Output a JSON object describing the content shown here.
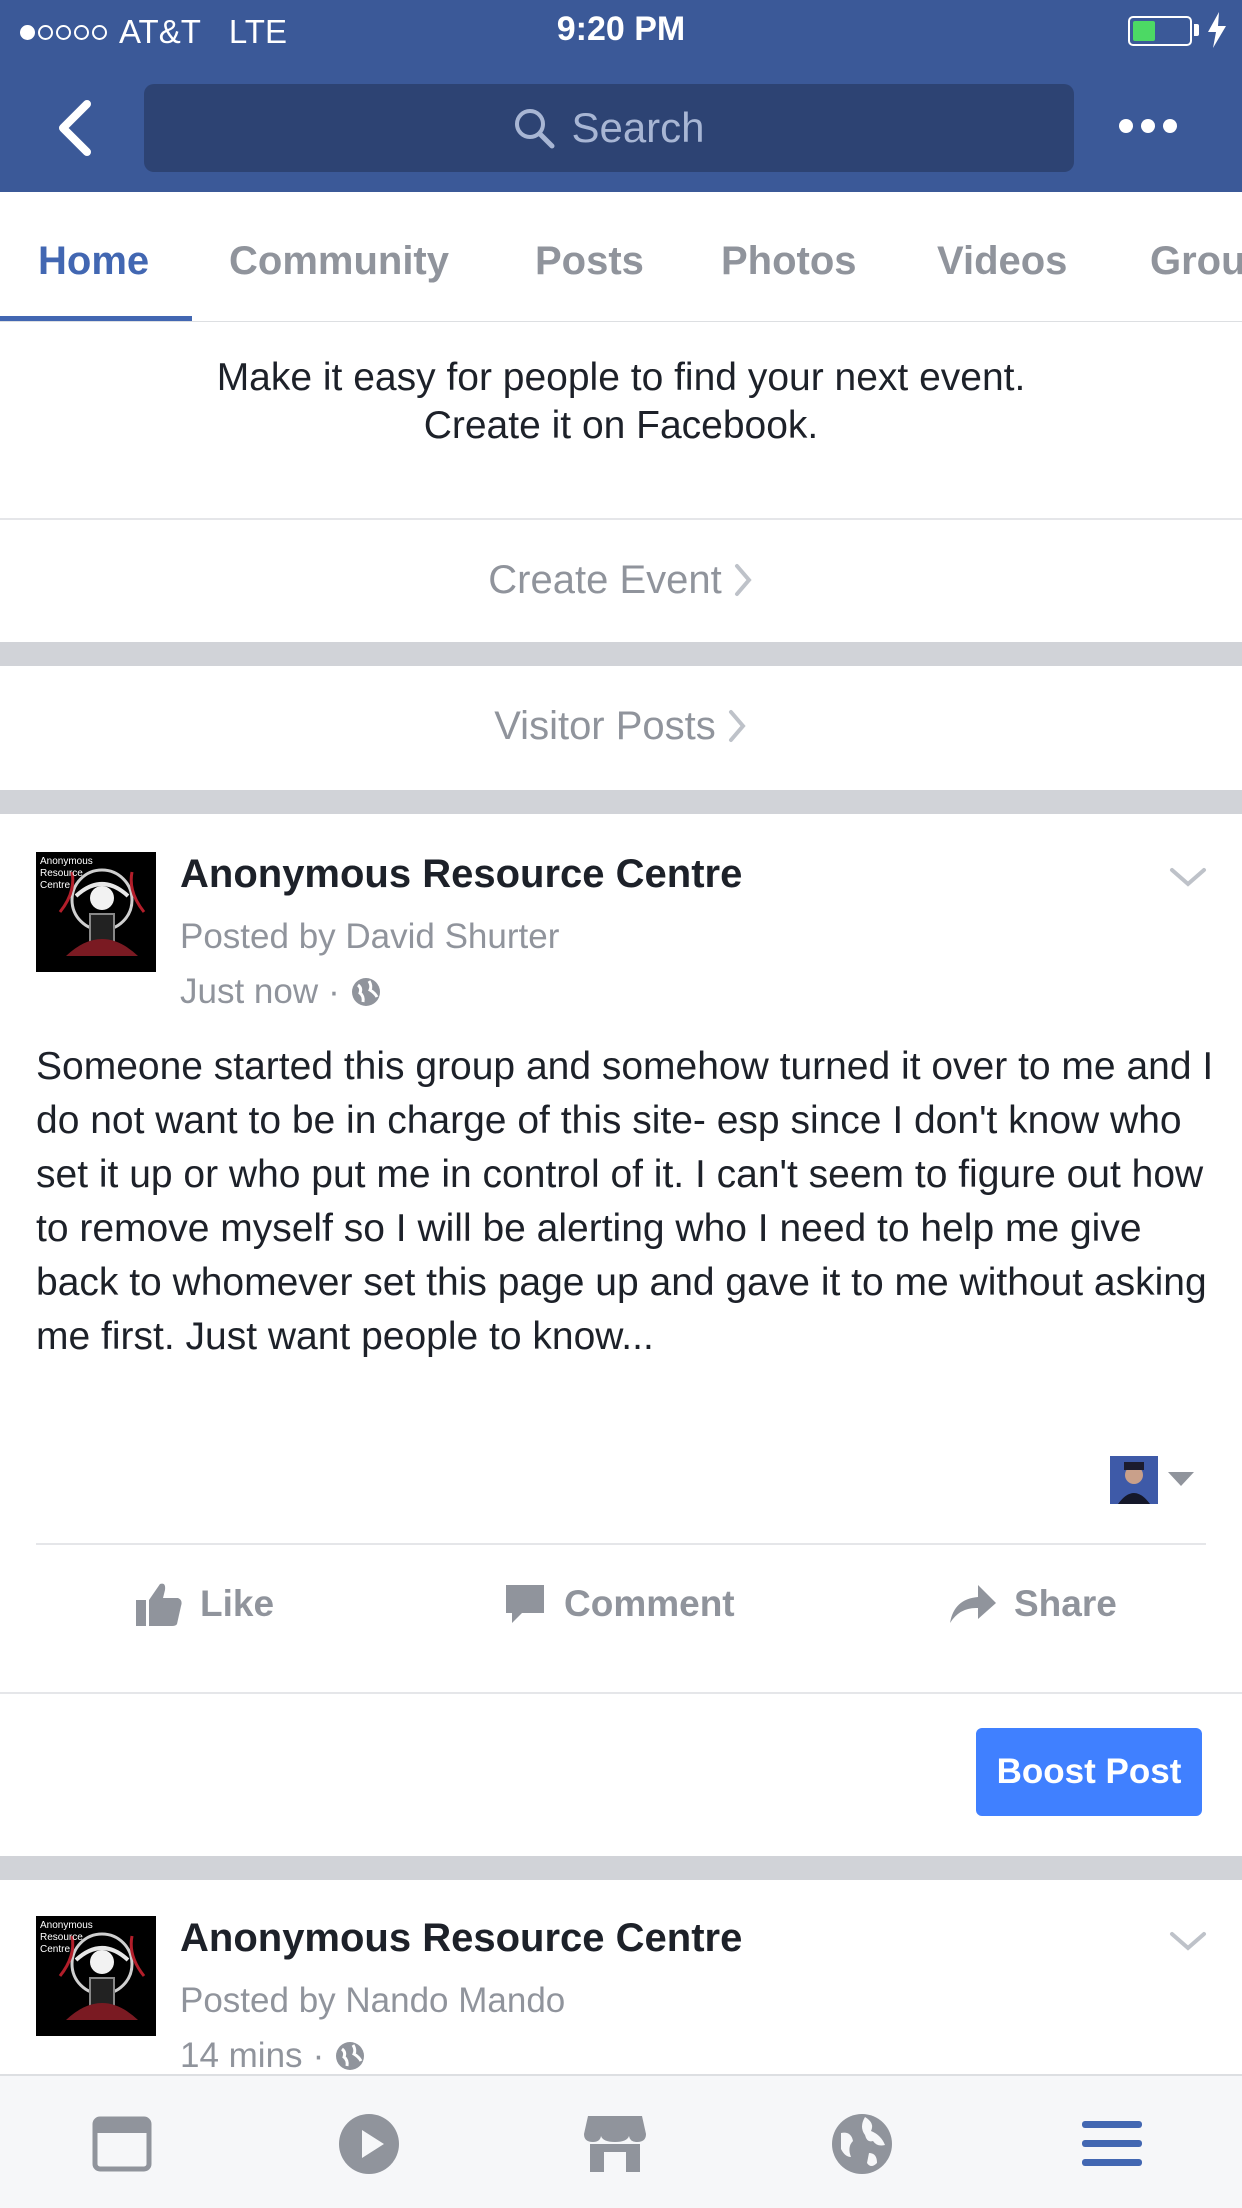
{
  "status_bar": {
    "carrier": "AT&T",
    "network": "LTE",
    "time": "9:20 PM",
    "signal_bars": 1,
    "battery_level": 0.3
  },
  "nav": {
    "search_placeholder": "Search",
    "back_icon": "chevron-left-icon",
    "more_icon": "more-dots-icon"
  },
  "tabs": [
    {
      "label": "Home",
      "active": true
    },
    {
      "label": "Community",
      "active": false
    },
    {
      "label": "Posts",
      "active": false
    },
    {
      "label": "Photos",
      "active": false
    },
    {
      "label": "Videos",
      "active": false
    },
    {
      "label": "Grou",
      "active": false
    }
  ],
  "event_promo": {
    "line1": "Make it easy for people to find your next event.",
    "line2": "Create it on Facebook.",
    "create_event_label": "Create Event"
  },
  "visitor_posts_label": "Visitor Posts",
  "posts": [
    {
      "page_name": "Anonymous Resource Centre",
      "posted_by": "Posted by David Shurter",
      "time": "Just now",
      "separator": "·",
      "avatar_text": "Anonymous Resource Centre",
      "body": "Someone started this group and somehow turned it over to me and I do not want to be in charge of this site- esp since I don't know who set it up or who put me in control of it.  I can't seem to figure out how to remove myself so I will be alerting who I need to help me give back to whomever set this page up and gave it to me without asking me first.  Just want people to know...",
      "actions": {
        "like": "Like",
        "comment": "Comment",
        "share": "Share"
      },
      "boost_label": "Boost Post"
    },
    {
      "page_name": "Anonymous Resource Centre",
      "posted_by": "Posted by Nando Mando",
      "time": "14 mins",
      "separator": "·",
      "avatar_text": "Anonymous Resource Centre"
    }
  ],
  "bottom_nav": [
    {
      "icon": "news-feed-icon",
      "active": false
    },
    {
      "icon": "video-play-icon",
      "active": false
    },
    {
      "icon": "marketplace-icon",
      "active": false
    },
    {
      "icon": "globe-notifications-icon",
      "active": false
    },
    {
      "icon": "menu-icon",
      "active": true
    }
  ],
  "colors": {
    "brand_blue": "#3b5998",
    "search_bg": "#2d4373",
    "active_tab": "#4267b2",
    "muted_text": "#90949c",
    "boost_button": "#4080ff",
    "battery_green": "#4cd964"
  }
}
